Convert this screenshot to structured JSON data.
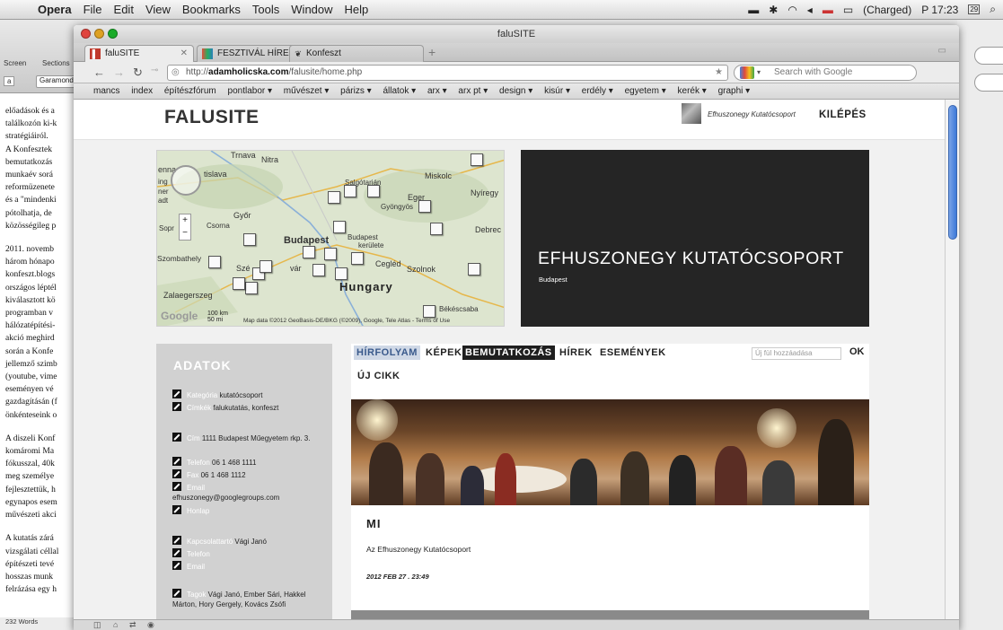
{
  "menubar": {
    "apple": "",
    "app": "Opera",
    "items": [
      "File",
      "Edit",
      "View",
      "Bookmarks",
      "Tools",
      "Window",
      "Help"
    ],
    "status": {
      "battery": "(Charged)",
      "clock": "P 17:23",
      "calendar_day": "29"
    }
  },
  "background_app": {
    "toolbar_labels": [
      "Screen",
      "Sections"
    ],
    "font_select": "Garamond",
    "zoom_select": "a",
    "doc_lines": [
      [
        "előadások és a",
        "találkozón ki-k",
        "stratégiáiról.",
        "A Konfesztek",
        "bemutatkozás",
        "munkaév sorá",
        "reformüzenete",
        "és a \"mindenki",
        "pótolhatja, de",
        "közösségileg p"
      ],
      [
        "2011. novemb",
        "három hónapo",
        "konfeszt.blogs",
        "országos léptél",
        "kiválasztott kö",
        "programban v",
        "hálózatépítési-",
        "akció meghird",
        "során a Konfe",
        "jellemző szimb",
        "(youtube, vime",
        "eseményen vé",
        "gazdagításán (f",
        "önkénteseink o"
      ],
      [
        "A diszeli Konf",
        "komáromi Ma",
        "fókusszal, 40k",
        "meg személye",
        "fejlesztettük, h",
        "egynapos esem",
        "művészeti akci"
      ],
      [
        "A kutatás zárá",
        "vizsgálati céllal",
        "építészeti tevé",
        "hosszas munk",
        "felrázása egy h"
      ]
    ],
    "word_count": "232 Words"
  },
  "window": {
    "title": "faluSITE",
    "tabs": [
      {
        "label": "faluSITE",
        "icon": "falusite-favicon"
      },
      {
        "label": "FESZTIVÁL HÍREK – ...",
        "icon": "colorful-favicon"
      },
      {
        "label": "Konfeszt",
        "icon": "heart-favicon"
      }
    ],
    "url_prefix": "http://",
    "url_host": "adamholicska.com",
    "url_path": "/falusite/home.php",
    "search_placeholder": "Search with Google",
    "bookmarks": [
      "mancs",
      "index",
      "építészfórum",
      "pontlabor ▾",
      "művészet ▾",
      "párizs ▾",
      "állatok ▾",
      "arx ▾",
      "arx pt ▾",
      "design ▾",
      "kisúr ▾",
      "erdély ▾",
      "egyetem ▾",
      "kerék ▾",
      "graphi ▾"
    ]
  },
  "site": {
    "logo": "FALUSITE",
    "user": "Efhuszonegy Kutatócsoport",
    "logout": "KILÉPÉS",
    "map": {
      "labels": [
        "Trnava",
        "Nitra",
        "enna",
        "tislava",
        "Salgótarján",
        "Miskolc",
        "Nyíregy",
        "Eger",
        "Gyöngyös",
        "Győr",
        "Csorna",
        "Sopr",
        "Debrec",
        "Budapest",
        "Budapest",
        "kerülete",
        "Szombathely",
        "Szé",
        "vár",
        "Cegléd",
        "Szolnok",
        "Zalaegerszeg",
        "Békéscsaba",
        "ing",
        "ner",
        "adt"
      ],
      "country": "Hungary",
      "attribution": "Map data ©2012 GeoBasis-DE/BKG (©2009), Google, Tele Atlas - Terms of Use",
      "scale_km": "100 km",
      "scale_mi": "50 mi",
      "google": "Google"
    },
    "profile": {
      "name": "EFHUSZONEGY KUTATÓCSOPORT",
      "city": "Budapest"
    },
    "sidebar": {
      "title": "ADATOK",
      "rows": [
        {
          "key": "Kategória",
          "val": "kutatócsoport"
        },
        {
          "key": "Címkék",
          "val": "falukutatás, konfeszt"
        },
        {
          "key": "Cím",
          "val": "1111 Budapest Műegyetem rkp. 3."
        },
        {
          "key": "Telefon",
          "val": "06 1 468 1111"
        },
        {
          "key": "Fax",
          "val": "06 1 468 1112"
        },
        {
          "key": "Email",
          "val": "efhuszonegy@googlegroups.com"
        },
        {
          "key": "Honlap",
          "val": ""
        },
        {
          "key": "Kapcsolattartó",
          "val": "Vági Janó"
        },
        {
          "key": "Telefon",
          "val": ""
        },
        {
          "key": "Email",
          "val": ""
        },
        {
          "key": "Tagok",
          "val": "Vági Janó, Ember Sári, Hakkel Márton, Hory Gergely, Kovács Zsófi"
        }
      ]
    },
    "nav": {
      "tabs": [
        "HÍRFOLYAM",
        "KÉPEK",
        "BEMUTATKOZÁS",
        "HÍREK",
        "ESEMÉNYEK"
      ],
      "title_placeholder": "Új fül hozzáadása",
      "ok": "OK"
    },
    "new_article": "ÚJ CIKK",
    "post": {
      "title": "MI",
      "desc": "Az Efhuszonegy Kutatócsoport",
      "date": "2012 FEB 27 . 23:49"
    }
  }
}
